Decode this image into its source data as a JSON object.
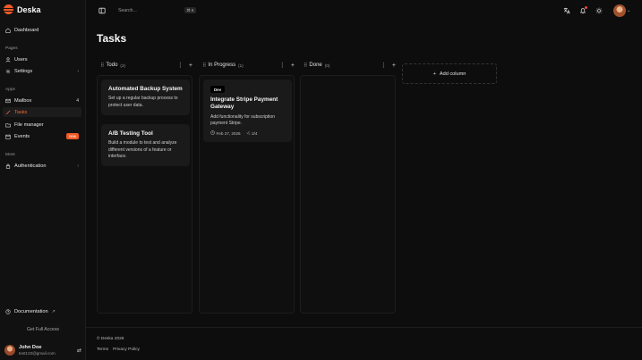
{
  "brand": {
    "name": "Deska",
    "color": "#f05a28"
  },
  "sidebar": {
    "sections": {
      "pages": "Pages",
      "apps": "Apps",
      "more": "More"
    },
    "items": [
      {
        "label": "Dashboard",
        "icon": "home-icon"
      },
      {
        "label": "Users",
        "icon": "user-icon"
      },
      {
        "label": "Settings",
        "icon": "gear-icon",
        "chevron": "›"
      },
      {
        "label": "Mailbox",
        "icon": "mail-icon",
        "count": "4"
      },
      {
        "label": "Tasks",
        "icon": "brush-icon",
        "active": true
      },
      {
        "label": "File manager",
        "icon": "folder-icon"
      },
      {
        "label": "Events",
        "icon": "calendar-icon",
        "badge": "new"
      },
      {
        "label": "Authentication",
        "icon": "lock-icon",
        "chevron": "›"
      }
    ],
    "documentation": {
      "label": "Documentation",
      "arrow": "↗"
    },
    "get_access": "Get Full Access",
    "user": {
      "name": "John Doe",
      "email": "test123@gmail.com"
    }
  },
  "topbar": {
    "search_placeholder": "Search...",
    "shortcut": "⌘ K"
  },
  "page": {
    "title": "Tasks"
  },
  "columns": [
    {
      "title": "Todo",
      "count": "(2)",
      "cards": [
        {
          "title": "Automated Backup System",
          "desc": "Set up a regular backup process to protect user data."
        },
        {
          "title": "A/B Testing Tool",
          "desc": "Build a module to test and analyze different versions of a feature or interface."
        }
      ]
    },
    {
      "title": "In Progress",
      "count": "(1)",
      "cards": [
        {
          "tag": "Dev",
          "title": "Integrate Stripe Payment Gateway",
          "desc": "Add functionality for subscription payment Stripe.",
          "date": "Feb 27, 2026",
          "subtasks": "2/4"
        }
      ]
    },
    {
      "title": "Done",
      "count": "(0)",
      "cards": []
    }
  ],
  "add_column": {
    "label": "Add column",
    "icon": "+"
  },
  "footer": {
    "copyright": "© Deska 2026",
    "terms": "Terms",
    "privacy": "Privacy Policy"
  }
}
